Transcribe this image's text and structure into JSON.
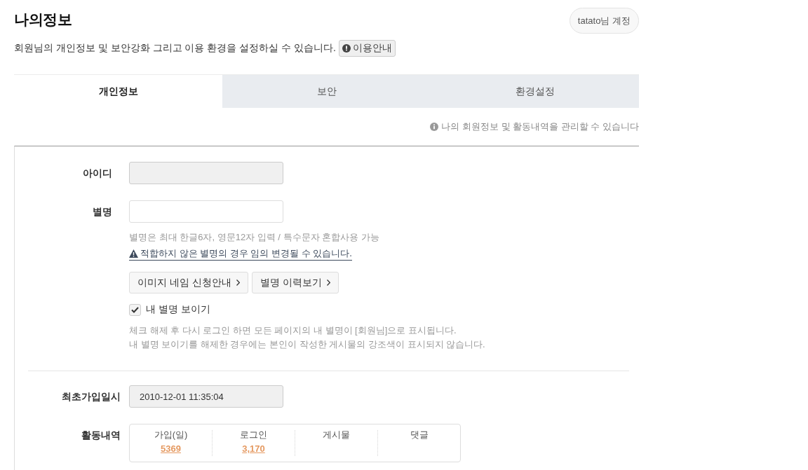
{
  "header": {
    "title": "나의정보",
    "account": "tatato님 계정",
    "description": "회원님의 개인정보 및 보안강화 그리고 이용 환경을 설정하실 수 있습니다.",
    "guide": "이용안내"
  },
  "tabs": [
    {
      "label": "개인정보",
      "selected": true
    },
    {
      "label": "보안",
      "selected": false
    },
    {
      "label": "환경설정",
      "selected": false
    }
  ],
  "notice": "나의 회원정보 및 활동내역을 관리할 수 있습니다",
  "profile": {
    "id": {
      "label": "아이디",
      "disabled": true
    },
    "nickname": {
      "label": "별명",
      "disabled": false,
      "hint": "별명은 최대 한글6자, 영문12자 입력 / 특수문자 혼합사용 가능",
      "warning": "적합하지 않은 별명의 경우 임의 변경될 수 있습니다.",
      "buttons": [
        "이미지 네임 신청안내",
        "별명 이력보기"
      ]
    },
    "show_nickname": {
      "label": "내 별명 보이기",
      "checked": true
    },
    "notes": [
      "체크 해제 후 다시 로그인 하면 모든 페이지의 내 별명이 [회원님]으로 표시됩니다.",
      "내 별명 보이기를 해제한 경우에는 본인이 작성한 게시물의 강조색이 표시되지 않습니다."
    ]
  },
  "history": {
    "joined": {
      "label": "최초가입일시",
      "value": "2010-12-01 11:35:04",
      "disabled": true
    },
    "activity": {
      "label": "활동내역",
      "stats": [
        {
          "label": "가입(일)",
          "value": "5369"
        },
        {
          "label": "로그인",
          "value": "3,170"
        },
        {
          "label": "게시물"
        },
        {
          "label": "댓글"
        }
      ]
    }
  }
}
